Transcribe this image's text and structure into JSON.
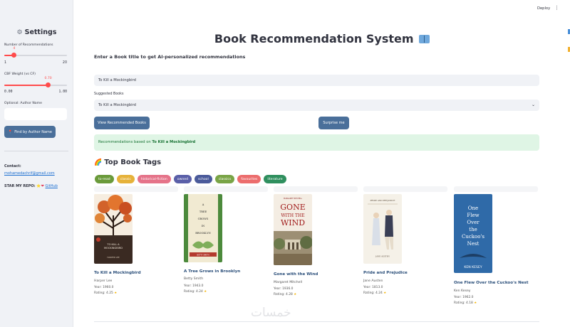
{
  "sidebar": {
    "title": "Settings",
    "num_recs_label": "Number of Recommendations",
    "num_recs_value": "4",
    "num_recs_fraction": 0.158,
    "num_recs_min": "1",
    "num_recs_max": "20",
    "cbf_label": "CBF Weight (vs CF)",
    "cbf_value": "0.70",
    "cbf_fraction": 0.7,
    "cbf_min": "0.00",
    "cbf_max": "1.00",
    "author_label": "Optional: Author Name",
    "author_value": "",
    "find_button": "Find by Author Name",
    "contact_label": "Contact:",
    "contact_email": "mohamedachrif@gmail.com",
    "repo_text": "STAR MY REPO:",
    "repo_link": "GitHub"
  },
  "header": {
    "deploy": "Deploy",
    "menu_icon": "kebab-menu-icon"
  },
  "main": {
    "title": "Book Recommendation System",
    "subtitle": "Enter a Book title to get AI-personalized recommendations",
    "title_input": "To Kill a Mockingbird",
    "suggested_label": "Suggested Books",
    "suggested_value": "To Kill a Mockingbird",
    "view_button": "View Recommended Books",
    "surprise_button": "Surprise me",
    "alert_prefix": "Recommendations based on",
    "alert_book": "To Kill a Mockingbird",
    "tags_heading": "Top Book Tags",
    "tags": [
      {
        "label": "to-read",
        "color": "#6a9a3a"
      },
      {
        "label": "classic",
        "color": "#e6b23a"
      },
      {
        "label": "historical-fiction",
        "color": "#e57389"
      },
      {
        "label": "owned",
        "color": "#5a5fa8"
      },
      {
        "label": "school",
        "color": "#4a5a9a"
      },
      {
        "label": "classics",
        "color": "#79a446"
      },
      {
        "label": "favourites",
        "color": "#ec6d6d"
      },
      {
        "label": "literature",
        "color": "#2f8f5e"
      }
    ],
    "books": [
      {
        "title": "To Kill a Mockingbird",
        "author": "Harper Lee",
        "year": "Year: 1960.0",
        "rating": "Rating: 4.25"
      },
      {
        "title": "A Tree Grows in Brooklyn",
        "author": "Betty Smith",
        "year": "Year: 1943.0",
        "rating": "Rating: 4.24"
      },
      {
        "title": "Gone with the Wind",
        "author": "Margaret Mitchell",
        "year": "Year: 1936.0",
        "rating": "Rating: 4.28"
      },
      {
        "title": "Pride and Prejudice",
        "author": "Jane Austen",
        "year": "Year: 1813.0",
        "rating": "Rating: 4.24"
      },
      {
        "title": "One Flew Over the Cuckoo's Nest",
        "author": "Ken Kesey",
        "year": "Year: 1962.0",
        "rating": "Rating: 4.18"
      }
    ],
    "covers": {
      "mockingbird": {
        "line1": "TO KILL A",
        "line2": "MOCKINGBIRD",
        "author": "HARPER LEE"
      },
      "brooklyn": {
        "line1": "A",
        "line2": "TREE",
        "line3": "GROWS",
        "line4": "IN",
        "line5": "BROOKLYN",
        "author": "BETTY SMITH"
      },
      "wind": {
        "author": "MARGARET MITCHELL",
        "line1": "GONE",
        "line2": "WITH THE",
        "line3": "WIND"
      },
      "pride": {
        "line1": "PRIDE AND PREJUDICE",
        "author": "JANE AUSTEN"
      },
      "cuckoo": {
        "line1": "One",
        "line2": "Flew",
        "line3": "Over",
        "line4": "the",
        "line5": "Cuckoo's",
        "line6": "Nest",
        "author": "KEN KESEY"
      }
    },
    "watermark": "خمسات"
  }
}
